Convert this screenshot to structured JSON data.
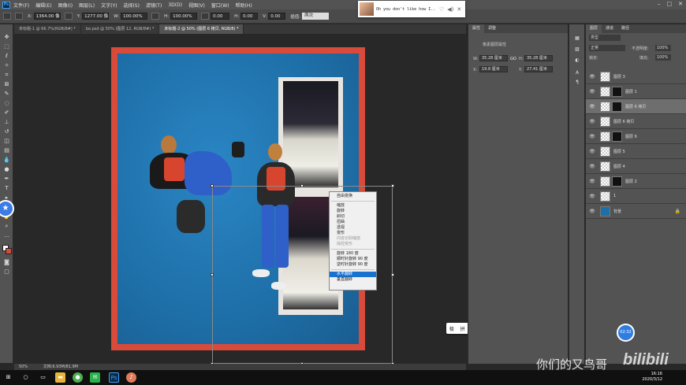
{
  "menubar": {
    "items": [
      "文件(F)",
      "编辑(E)",
      "图像(I)",
      "图层(L)",
      "文字(Y)",
      "选择(S)",
      "滤镜(T)",
      "3D(D)",
      "视图(V)",
      "窗口(W)",
      "帮助(H)"
    ]
  },
  "options": {
    "x_label": "X:",
    "x_value": "1364.00 像",
    "y_label": "Y:",
    "y_value": "1277.00 像",
    "w_label": "W:",
    "w_value": "100.00%",
    "h_label": "H:",
    "h_value": "100.00%",
    "angle_value": "0.00",
    "hskew_label": "H:",
    "hskew_value": "0.00",
    "vskew_label": "V:",
    "vskew_value": "0.00",
    "interp_label": "插值:",
    "interp_value": "两次"
  },
  "music": {
    "song": "Oh you don't like how I..."
  },
  "tabs": [
    {
      "label": "未标题-1 @ 66.7%(RGB/8#) *",
      "active": false
    },
    {
      "label": "bo.psd @ 50% (图层 12, RGB/8#) *",
      "active": false
    },
    {
      "label": "未标题-2 @ 50% (图层 6 拷贝, RGB/8) *",
      "active": true
    }
  ],
  "context_menu": {
    "items": [
      {
        "label": "自由变换",
        "type": "normal"
      },
      {
        "type": "sep"
      },
      {
        "label": "缩放",
        "type": "normal"
      },
      {
        "label": "旋转",
        "type": "normal"
      },
      {
        "label": "斜切",
        "type": "normal"
      },
      {
        "label": "扭曲",
        "type": "normal"
      },
      {
        "label": "透视",
        "type": "normal"
      },
      {
        "label": "变形",
        "type": "normal"
      },
      {
        "label": "内容识别缩放",
        "type": "disabled"
      },
      {
        "label": "操控变形",
        "type": "disabled"
      },
      {
        "type": "sep"
      },
      {
        "label": "旋转 180 度",
        "type": "normal"
      },
      {
        "label": "顺时针旋转 90 度",
        "type": "normal"
      },
      {
        "label": "逆时针旋转 90 度",
        "type": "normal"
      },
      {
        "type": "sep"
      },
      {
        "label": "水平翻转",
        "type": "highlight"
      },
      {
        "label": "垂直翻转",
        "type": "normal"
      }
    ]
  },
  "status": {
    "zoom": "50%",
    "doc": "文档:6.93M/81.9M"
  },
  "ime": {
    "items": [
      "极",
      "拼",
      "中",
      "↻",
      "⚙",
      "✖"
    ]
  },
  "properties": {
    "tabs": [
      "属性",
      "调整"
    ],
    "heading": "像素图层属性",
    "w_label": "W:",
    "w_value": "35.28 厘米",
    "link": "GO",
    "h_label": "H:",
    "h_value": "35.28 厘米",
    "x_label": "X:",
    "x_value": "19.8 厘米",
    "y_label": "Y:",
    "y_value": "27.41 厘米"
  },
  "layers_panel": {
    "tabs": [
      "图层",
      "通道",
      "路径"
    ],
    "kind": "类型",
    "mode": "正常",
    "opacity_label": "不透明度:",
    "opacity": "100%",
    "lock_label": "锁定:",
    "fill_label": "填充:",
    "fill": "100%",
    "layers": [
      {
        "name": "图层 3",
        "mask": false,
        "selected": false
      },
      {
        "name": "图层 1",
        "mask": true,
        "selected": false
      },
      {
        "name": "图层 6 拷贝",
        "mask": true,
        "selected": true
      },
      {
        "name": "图层 6 拷贝",
        "mask": false,
        "selected": false
      },
      {
        "name": "图层 6",
        "mask": true,
        "selected": false
      },
      {
        "name": "图层 5",
        "mask": false,
        "selected": false
      },
      {
        "name": "图层 4",
        "mask": false,
        "selected": false
      },
      {
        "name": "图层 2",
        "mask": true,
        "selected": false
      },
      {
        "name": "1",
        "mask": false,
        "selected": false
      },
      {
        "name": "背景",
        "mask": false,
        "selected": false
      }
    ]
  },
  "taskbar": {
    "time": "16:16",
    "date": "2020/3/12"
  },
  "watermark": {
    "name": "你们的又鸟哥",
    "logo": "bilibili",
    "badge": "02:32"
  },
  "colors": {
    "accent": "#1a72d0",
    "frame_red": "#d84a3a",
    "canvas_blue": "#1e6fa8"
  }
}
